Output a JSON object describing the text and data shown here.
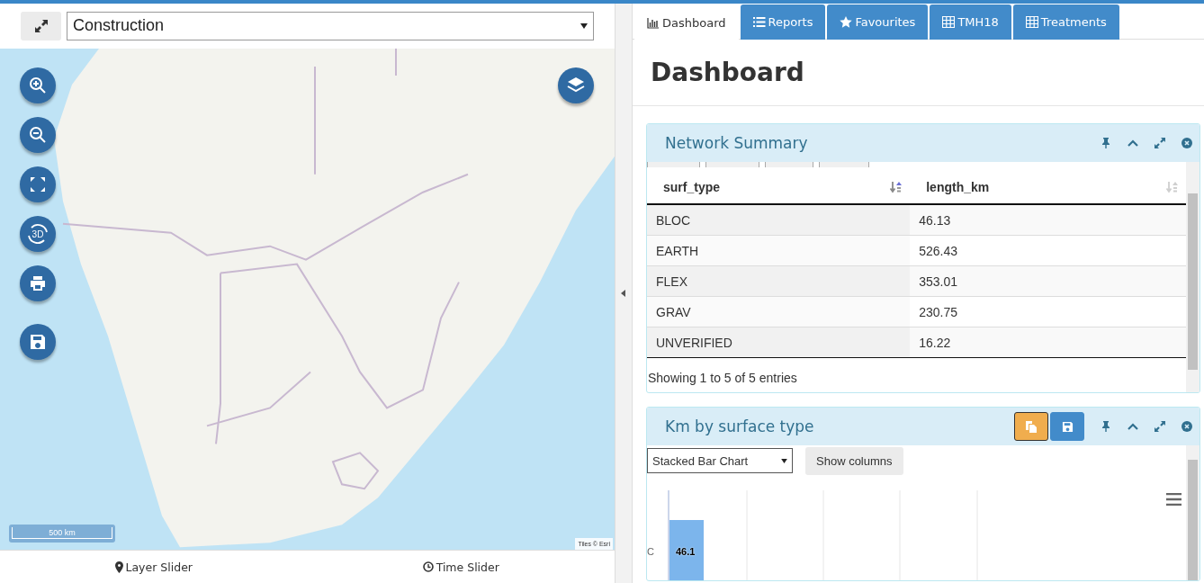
{
  "map_panel": {
    "layer_select": {
      "value": "Construction"
    },
    "rotate_label": "3D",
    "scale_label": "500 km",
    "attribution": "Tiles © Esri",
    "footer": [
      {
        "label": "Layer Slider"
      },
      {
        "label": "Time Slider"
      }
    ]
  },
  "tabs": [
    {
      "label": "Dashboard",
      "selected": true
    },
    {
      "label": "Reports",
      "selected": false
    },
    {
      "label": "Favourites",
      "selected": false
    },
    {
      "label": "TMH18",
      "selected": false
    },
    {
      "label": "Treatments",
      "selected": false
    }
  ],
  "page_title": "Dashboard",
  "network_summary": {
    "title": "Network Summary",
    "columns": [
      {
        "label": "surf_type",
        "sorted": true
      },
      {
        "label": "length_km",
        "sorted": false
      }
    ],
    "rows": [
      [
        "BLOC",
        "46.13"
      ],
      [
        "EARTH",
        "526.43"
      ],
      [
        "FLEX",
        "353.01"
      ],
      [
        "GRAV",
        "230.75"
      ],
      [
        "UNVERIFIED",
        "16.22"
      ]
    ],
    "info": "Showing 1 to 5 of 5 entries"
  },
  "km_panel": {
    "title": "Km by surface type",
    "chart_type": {
      "value": "Stacked Bar Chart"
    },
    "show_columns": "Show columns",
    "category_label": "C",
    "bar_label": "46.1"
  }
}
